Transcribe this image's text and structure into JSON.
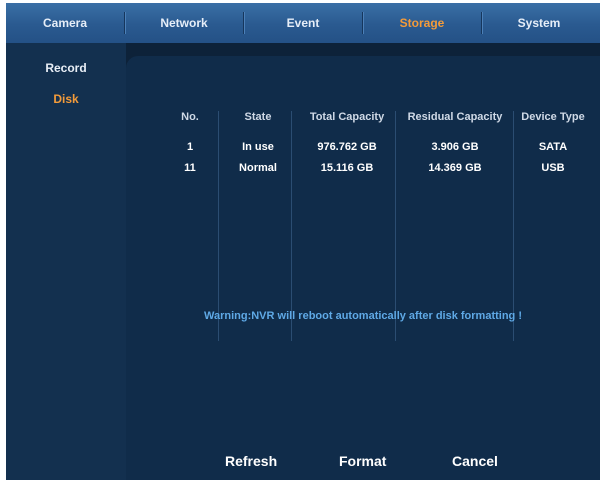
{
  "tabs": [
    {
      "label": "Camera",
      "active": false
    },
    {
      "label": "Network",
      "active": false
    },
    {
      "label": "Event",
      "active": false
    },
    {
      "label": "Storage",
      "active": true
    },
    {
      "label": "System",
      "active": false
    }
  ],
  "sidebar": {
    "items": [
      {
        "label": "Record",
        "active": false
      },
      {
        "label": "Disk",
        "active": true
      }
    ]
  },
  "table": {
    "headers": [
      "No.",
      "State",
      "Total Capacity",
      "Residual Capacity",
      "Device Type"
    ],
    "rows": [
      [
        "1",
        "In use",
        "976.762 GB",
        "3.906 GB",
        "SATA"
      ],
      [
        "11",
        "Normal",
        "15.116 GB",
        "14.369 GB",
        "USB"
      ]
    ]
  },
  "warning": "Warning:NVR will reboot automatically after disk formatting !",
  "buttons": {
    "refresh": "Refresh",
    "format": "Format",
    "cancel": "Cancel"
  },
  "colors": {
    "active": "#f39b3a",
    "warning": "#5fa9e6",
    "background": "#0d2239"
  }
}
